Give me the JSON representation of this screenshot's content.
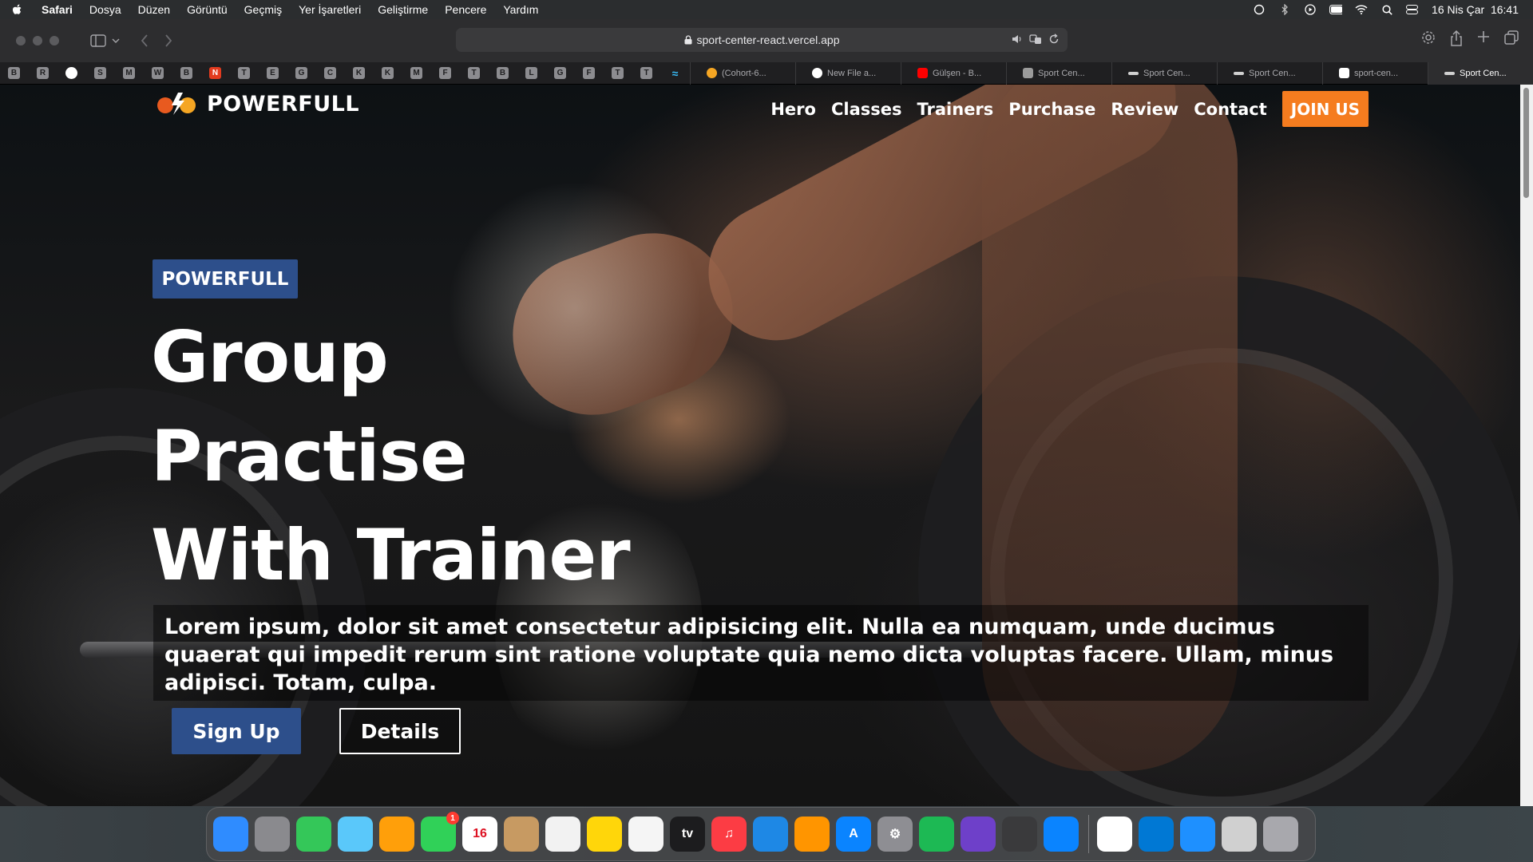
{
  "menubar": {
    "app": "Safari",
    "items": [
      "Dosya",
      "Düzen",
      "Görüntü",
      "Geçmiş",
      "Yer İşaretleri",
      "Geliştirme",
      "Pencere",
      "Yardım"
    ],
    "clock": "16 Nis Çar  16:41",
    "icons": [
      "openai-icon",
      "bluetooth-icon",
      "play-icon",
      "battery-icon",
      "wifi-icon",
      "search-icon",
      "control-center-icon"
    ]
  },
  "toolbar": {
    "url": "sport-center-react.vercel.app"
  },
  "favorites": [
    "B",
    "R",
    "",
    "S",
    "M",
    "W",
    "B",
    "N",
    "T",
    "E",
    "G",
    "C",
    "K",
    "K",
    "M",
    "F",
    "T",
    "B",
    "L",
    "G",
    "F",
    "T",
    "T"
  ],
  "tabs": [
    {
      "title": "(Cohort-6...",
      "icon_color": "#f5a623"
    },
    {
      "title": "New File a...",
      "icon_color": "#ffffff"
    },
    {
      "title": "Gülşen - B...",
      "icon_color": "#ff0000"
    },
    {
      "title": "Sport Cen...",
      "icon_color": "#9b9b9b"
    },
    {
      "title": "Sport Cen...",
      "icon_color": "#d0d0d0"
    },
    {
      "title": "Sport Cen...",
      "icon_color": "#d0d0d0"
    },
    {
      "title": "sport-cen...",
      "icon_color": "#ffffff"
    },
    {
      "title": "Sport Cen...",
      "icon_color": "#d0d0d0"
    }
  ],
  "site": {
    "logo_text": "POWERFULL",
    "nav": [
      "Hero",
      "Classes",
      "Trainers",
      "Purchase",
      "Review",
      "Contact"
    ],
    "join_label": "JOIN US",
    "badge": "POWERFULL",
    "title_lines": [
      "Group",
      "Practise",
      "With Trainer"
    ],
    "description": "Lorem ipsum, dolor sit amet consectetur adipisicing elit. Nulla ea numquam, unde ducimus quaerat qui impedit rerum sint ratione voluptate quia nemo dicta voluptas facere. Ullam, minus adipisci. Totam, culpa.",
    "signup_label": "Sign Up",
    "details_label": "Details",
    "colors": {
      "accent_orange": "#f57c1f",
      "accent_blue": "#2d4f8b"
    }
  },
  "dock": {
    "items": [
      {
        "name": "finder-icon",
        "color": "#2f8cff",
        "label": ""
      },
      {
        "name": "launchpad-icon",
        "color": "#8a8a8e",
        "label": ""
      },
      {
        "name": "messages-icon",
        "color": "#34c759",
        "label": ""
      },
      {
        "name": "maps-icon",
        "color": "#5ac8fa",
        "label": ""
      },
      {
        "name": "photos-icon",
        "color": "#ff9f0a",
        "label": ""
      },
      {
        "name": "facetime-icon",
        "color": "#30d158",
        "label": "",
        "badge": "1"
      },
      {
        "name": "calendar-icon",
        "color": "#ffffff",
        "label": "16"
      },
      {
        "name": "contacts-icon",
        "color": "#c79a62",
        "label": ""
      },
      {
        "name": "reminders-icon",
        "color": "#f2f2f2",
        "label": ""
      },
      {
        "name": "notes-icon",
        "color": "#ffd60a",
        "label": ""
      },
      {
        "name": "freeform-icon",
        "color": "#f5f5f5",
        "label": ""
      },
      {
        "name": "appletv-icon",
        "color": "#1c1c1e",
        "label": "tv"
      },
      {
        "name": "music-icon",
        "color": "#fc3c44",
        "label": "♫"
      },
      {
        "name": "keynote-icon",
        "color": "#1e88e5",
        "label": ""
      },
      {
        "name": "pages-icon",
        "color": "#ff9500",
        "label": ""
      },
      {
        "name": "appstore-icon",
        "color": "#0a84ff",
        "label": "A"
      },
      {
        "name": "system-settings-icon",
        "color": "#8e8e93",
        "label": "⚙"
      },
      {
        "name": "spotify-icon",
        "color": "#1db954",
        "label": ""
      },
      {
        "name": "github-desktop-icon",
        "color": "#6e40c9",
        "label": ""
      },
      {
        "name": "chatgpt-icon",
        "color": "#3a3a3c",
        "label": ""
      },
      {
        "name": "safari-icon",
        "color": "#0a84ff",
        "label": ""
      }
    ],
    "items_right": [
      {
        "name": "chrome-icon",
        "color": "#ffffff",
        "label": ""
      },
      {
        "name": "vscode-icon",
        "color": "#0078d4",
        "label": ""
      },
      {
        "name": "xcode-icon",
        "color": "#1e90ff",
        "label": ""
      },
      {
        "name": "preview-icon",
        "color": "#d0d0d0",
        "label": ""
      },
      {
        "name": "trash-icon",
        "color": "#a8a8ad",
        "label": ""
      }
    ]
  }
}
